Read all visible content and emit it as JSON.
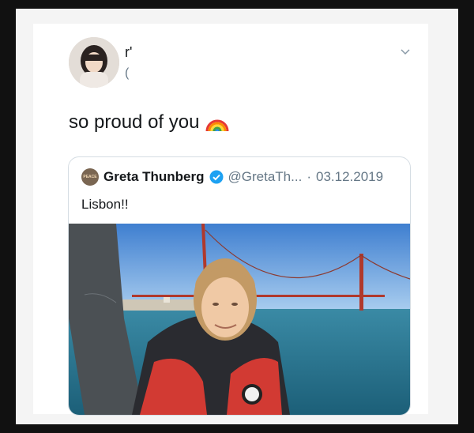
{
  "tweet": {
    "author_name_partial": "r'",
    "author_handle_partial": "(",
    "text": "so proud of you",
    "emoji": "rainbow-emoji"
  },
  "quoted_tweet": {
    "avatar_text": "PEACE",
    "author_name": "Greta Thunberg",
    "handle": "@GretaTh...",
    "separator": "·",
    "date": "03.12.2019",
    "text": "Lisbon!!"
  },
  "icons": {
    "menu": "chevron-down-icon",
    "verified": "verified-badge-icon"
  },
  "colors": {
    "verified_blue": "#1da1f2",
    "text_primary": "#14171a",
    "text_secondary": "#657786",
    "border": "#d5dde3"
  }
}
